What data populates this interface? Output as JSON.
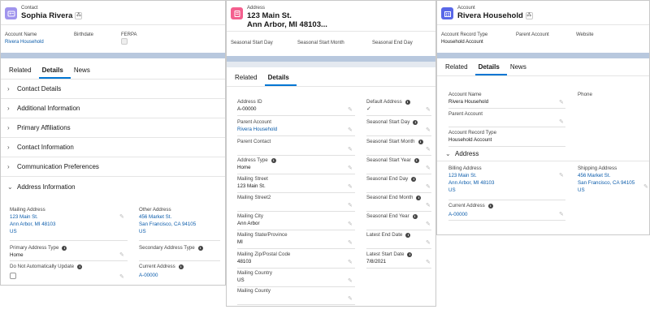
{
  "contact": {
    "type": "Contact",
    "name": "Sophia Rivera",
    "highlights": [
      {
        "label": "Account Name",
        "value": "Rivera Household"
      },
      {
        "label": "Birthdate",
        "value": ""
      },
      {
        "label": "FERPA",
        "value": ""
      }
    ],
    "tabs": [
      "Related",
      "Details",
      "News"
    ],
    "sections": [
      "Contact Details",
      "Additional Information",
      "Primary Affiliations",
      "Contact Information",
      "Communication Preferences",
      "Address Information"
    ],
    "fields": {
      "mailing_address_label": "Mailing Address",
      "mailing_address_l1": "123 Main St.",
      "mailing_address_l2": "Ann Arbor, MI 48103",
      "mailing_address_l3": "US",
      "other_address_label": "Other Address",
      "other_address_l1": "456 Market St.",
      "other_address_l2": "San Francisco, CA 94105",
      "other_address_l3": "US",
      "primary_address_type_label": "Primary Address Type",
      "primary_address_type": "Home",
      "secondary_address_type_label": "Secondary Address Type",
      "dnau_label": "Do Not Automatically Update",
      "current_address_label": "Current Address",
      "current_address": "A-00000"
    }
  },
  "address": {
    "type": "Address",
    "title_l1": "123 Main St.",
    "title_l2": "Ann Arbor, MI 48103...",
    "highlights": [
      "Seasonal Start Day",
      "Seasonal Start Month",
      "Seasonal End Day"
    ],
    "tabs": [
      "Related",
      "Details"
    ],
    "left": [
      {
        "label": "Address ID",
        "value": "A-00000"
      },
      {
        "label": "Parent Account",
        "value": "Rivera Household"
      },
      {
        "label": "Parent Contact",
        "value": ""
      },
      {
        "label": "Address Type",
        "value": "Home"
      },
      {
        "label": "Mailing Street",
        "value": "123 Main St."
      },
      {
        "label": "Mailing Street2",
        "value": ""
      },
      {
        "label": "Mailing City",
        "value": "Ann Arbor"
      },
      {
        "label": "Mailing State/Province",
        "value": "MI"
      },
      {
        "label": "Mailing Zip/Postal Code",
        "value": "48103"
      },
      {
        "label": "Mailing Country",
        "value": "US"
      },
      {
        "label": "Mailing County",
        "value": ""
      }
    ],
    "right": [
      {
        "label": "Default Address",
        "value": ""
      },
      {
        "label": "Seasonal Start Day",
        "value": ""
      },
      {
        "label": "Seasonal Start Month",
        "value": ""
      },
      {
        "label": "Seasonal Start Year",
        "value": ""
      },
      {
        "label": "Seasonal End Day",
        "value": ""
      },
      {
        "label": "Seasonal End Month",
        "value": ""
      },
      {
        "label": "Seasonal End Year",
        "value": ""
      },
      {
        "label": "Latest End Date",
        "value": ""
      },
      {
        "label": "Latest Start Date",
        "value": "7/8/2021"
      }
    ]
  },
  "account": {
    "type": "Account",
    "name": "Rivera Household",
    "highlights": [
      {
        "label": "Account Record Type",
        "value": "Household Account"
      },
      {
        "label": "Parent Account",
        "value": ""
      },
      {
        "label": "Website",
        "value": ""
      }
    ],
    "tabs": [
      "Related",
      "Details",
      "News"
    ],
    "fields": {
      "account_name_label": "Account Name",
      "account_name": "Rivera Household",
      "phone_label": "Phone",
      "parent_account_label": "Parent Account",
      "record_type_label": "Account Record Type",
      "record_type": "Household Account",
      "address_section": "Address",
      "billing_label": "Billing Address",
      "billing_l1": "123 Main St.",
      "billing_l2": "Ann Arbor, MI 48103",
      "billing_l3": "US",
      "shipping_label": "Shipping Address",
      "shipping_l1": "456 Market St.",
      "shipping_l2": "San Francisco, CA 94105",
      "shipping_l3": "US",
      "current_label": "Current Address",
      "current": "A-00000"
    }
  },
  "colors": {
    "contact_icon": "#a094ed",
    "address_icon": "#f45f8e",
    "account_icon": "#5867e8",
    "link": "#0b5cab",
    "tab_active": "#0176d3"
  }
}
